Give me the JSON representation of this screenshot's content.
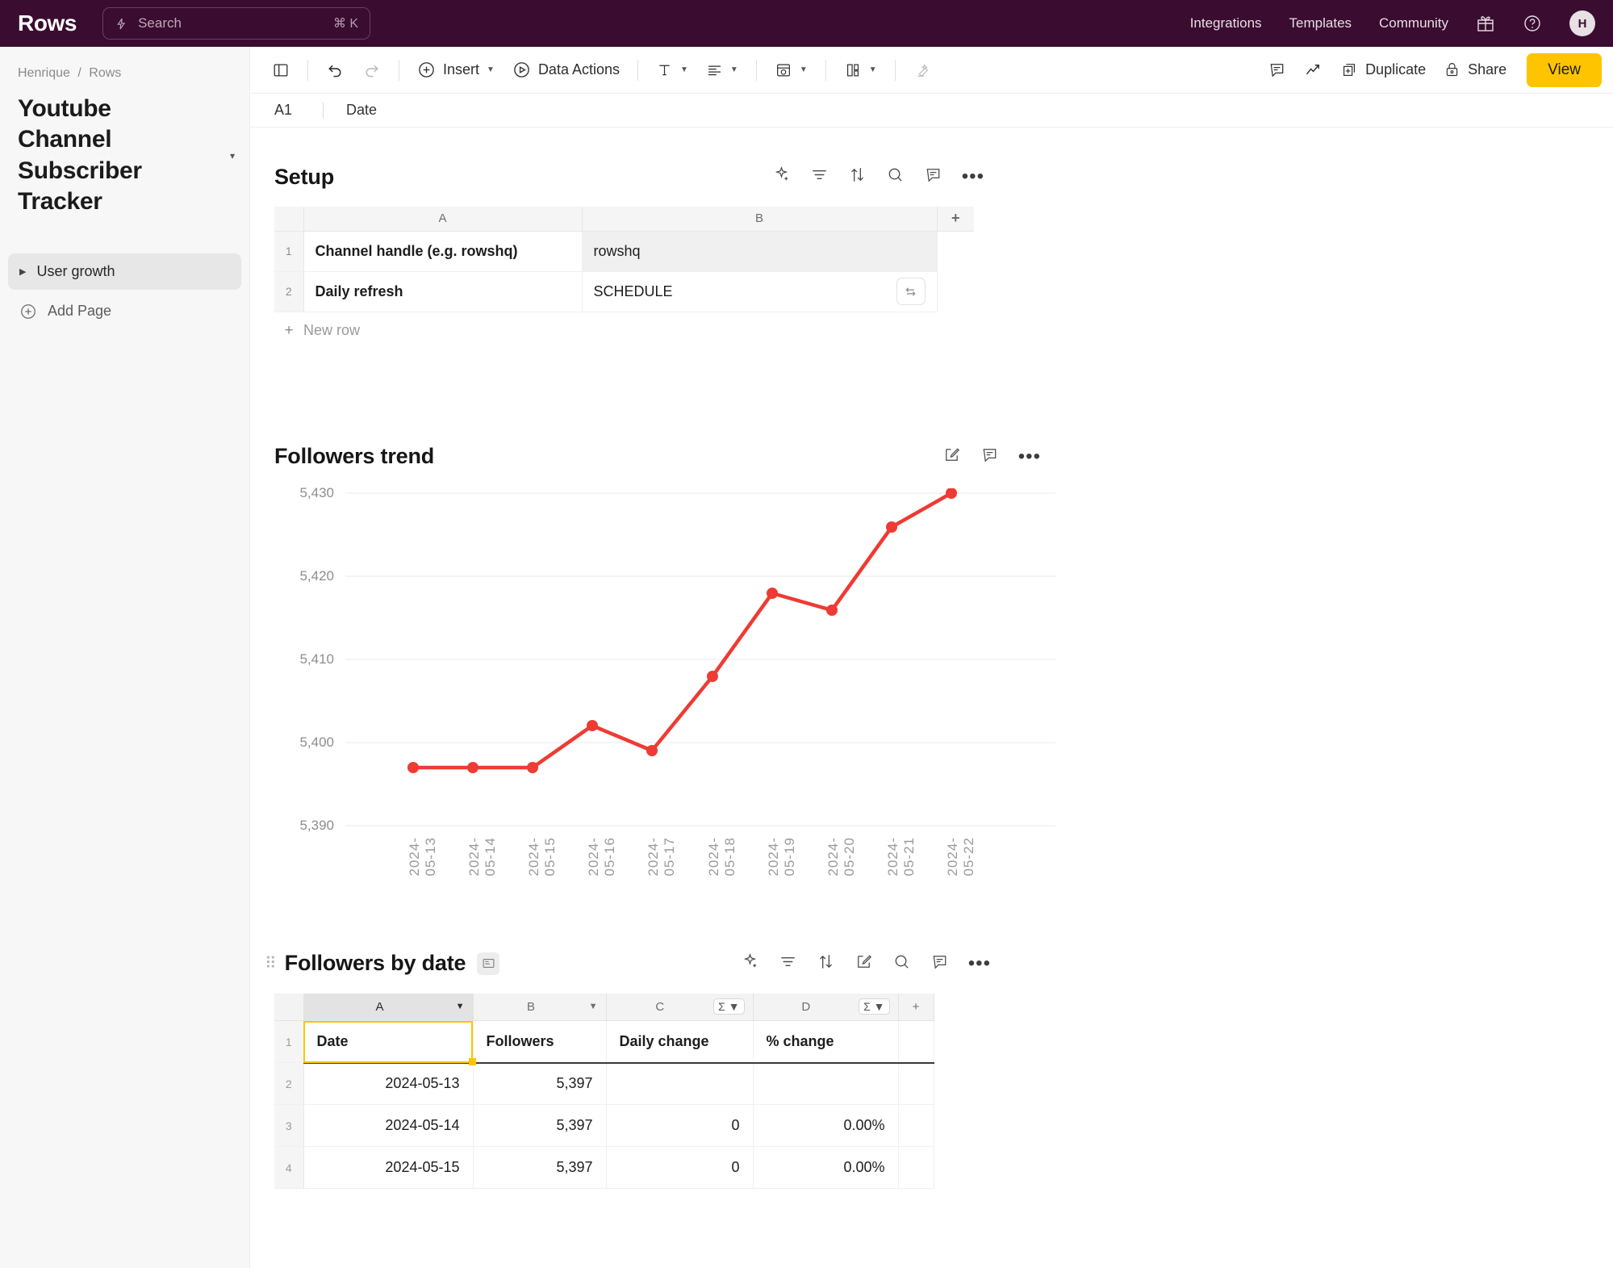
{
  "topbar": {
    "brand": "Rows",
    "search": {
      "placeholder": "Search",
      "shortcut": "⌘ K",
      "icon": "bolt-icon"
    },
    "nav": [
      {
        "label": "Integrations"
      },
      {
        "label": "Templates"
      },
      {
        "label": "Community"
      }
    ],
    "gift_icon": "gift-icon",
    "help_icon": "help-circle-icon",
    "avatar_initial": "H"
  },
  "toolbar": {
    "sidebar_toggle": "panel-icon",
    "undo": "undo-icon",
    "redo": "redo-icon",
    "insert_label": "Insert",
    "data_actions_label": "Data Actions",
    "text_format": "text-format-icon",
    "align": "align-icon",
    "table_style": "table-style-icon",
    "layout": "layout-icon",
    "clear_format": "clear-format-icon",
    "comment": "comment-icon",
    "analytics": "trend-icon",
    "duplicate_label": "Duplicate",
    "share_label": "Share",
    "view_label": "View"
  },
  "formula_bar": {
    "cell_ref": "A1",
    "value": "Date"
  },
  "sidebar": {
    "breadcrumb": {
      "owner": "Henrique",
      "separator": "/",
      "workspace": "Rows"
    },
    "doc_title": "Youtube Channel Subscriber Tracker",
    "caret": "▾",
    "pages": [
      {
        "label": "User growth",
        "active": true
      }
    ],
    "add_page_label": "Add Page"
  },
  "setup_block": {
    "title": "Setup",
    "icons": [
      "magic-icon",
      "filter-icon",
      "sort-icon",
      "search-icon",
      "comment-icon",
      "more-icon"
    ],
    "columns": [
      "A",
      "B"
    ],
    "add_column": "+",
    "rows": [
      {
        "n": "1",
        "a": "Channel handle (e.g. rowshq)",
        "b": "rowshq",
        "b_shaded": true
      },
      {
        "n": "2",
        "a": "Daily refresh",
        "b": "SCHEDULE",
        "b_shaded": false,
        "refresh_icon": "refresh-icon"
      }
    ],
    "new_row_label": "New row"
  },
  "chart_block": {
    "title": "Followers trend",
    "icons": [
      "edit-icon",
      "comment-icon",
      "more-icon"
    ]
  },
  "chart_data": {
    "type": "line",
    "title": "Followers trend",
    "xlabel": "",
    "ylabel": "",
    "series_color": "#EE3B33",
    "grid": true,
    "legend": "none",
    "ylim": [
      5390,
      5430
    ],
    "yticks": [
      "5,390",
      "5,400",
      "5,410",
      "5,420",
      "5,430"
    ],
    "ytick_values": [
      5390,
      5400,
      5410,
      5420,
      5430
    ],
    "categories": [
      "2024-05-13",
      "2024-05-14",
      "2024-05-15",
      "2024-05-16",
      "2024-05-17",
      "2024-05-18",
      "2024-05-19",
      "2024-05-20",
      "2024-05-21",
      "2024-05-22"
    ],
    "values": [
      5397,
      5397,
      5397,
      5402,
      5399,
      5408,
      5418,
      5416,
      5426,
      5430
    ]
  },
  "table_block": {
    "title": "Followers by date",
    "drag_handle": "drag-handle-icon",
    "tag_icon": "table-tag-icon",
    "icons": [
      "magic-icon",
      "filter-icon",
      "sort-icon",
      "edit-icon",
      "search-icon",
      "comment-icon",
      "more-icon"
    ],
    "columns": [
      {
        "letter": "A",
        "control": "caret",
        "selected": true
      },
      {
        "letter": "B",
        "control": "caret",
        "selected": false
      },
      {
        "letter": "C",
        "control": "sigma",
        "selected": false
      },
      {
        "letter": "D",
        "control": "sigma",
        "selected": false
      }
    ],
    "add_column": "+",
    "header_row": {
      "n": "1",
      "cells": [
        "Date",
        "Followers",
        "Daily change",
        "% change"
      ]
    },
    "rows": [
      {
        "n": "2",
        "date": "2024-05-13",
        "followers": "5,397",
        "daily_change": "",
        "pct_change": ""
      },
      {
        "n": "3",
        "date": "2024-05-14",
        "followers": "5,397",
        "daily_change": "0",
        "pct_change": "0.00%"
      },
      {
        "n": "4",
        "date": "2024-05-15",
        "followers": "5,397",
        "daily_change": "0",
        "pct_change": "0.00%"
      }
    ]
  }
}
